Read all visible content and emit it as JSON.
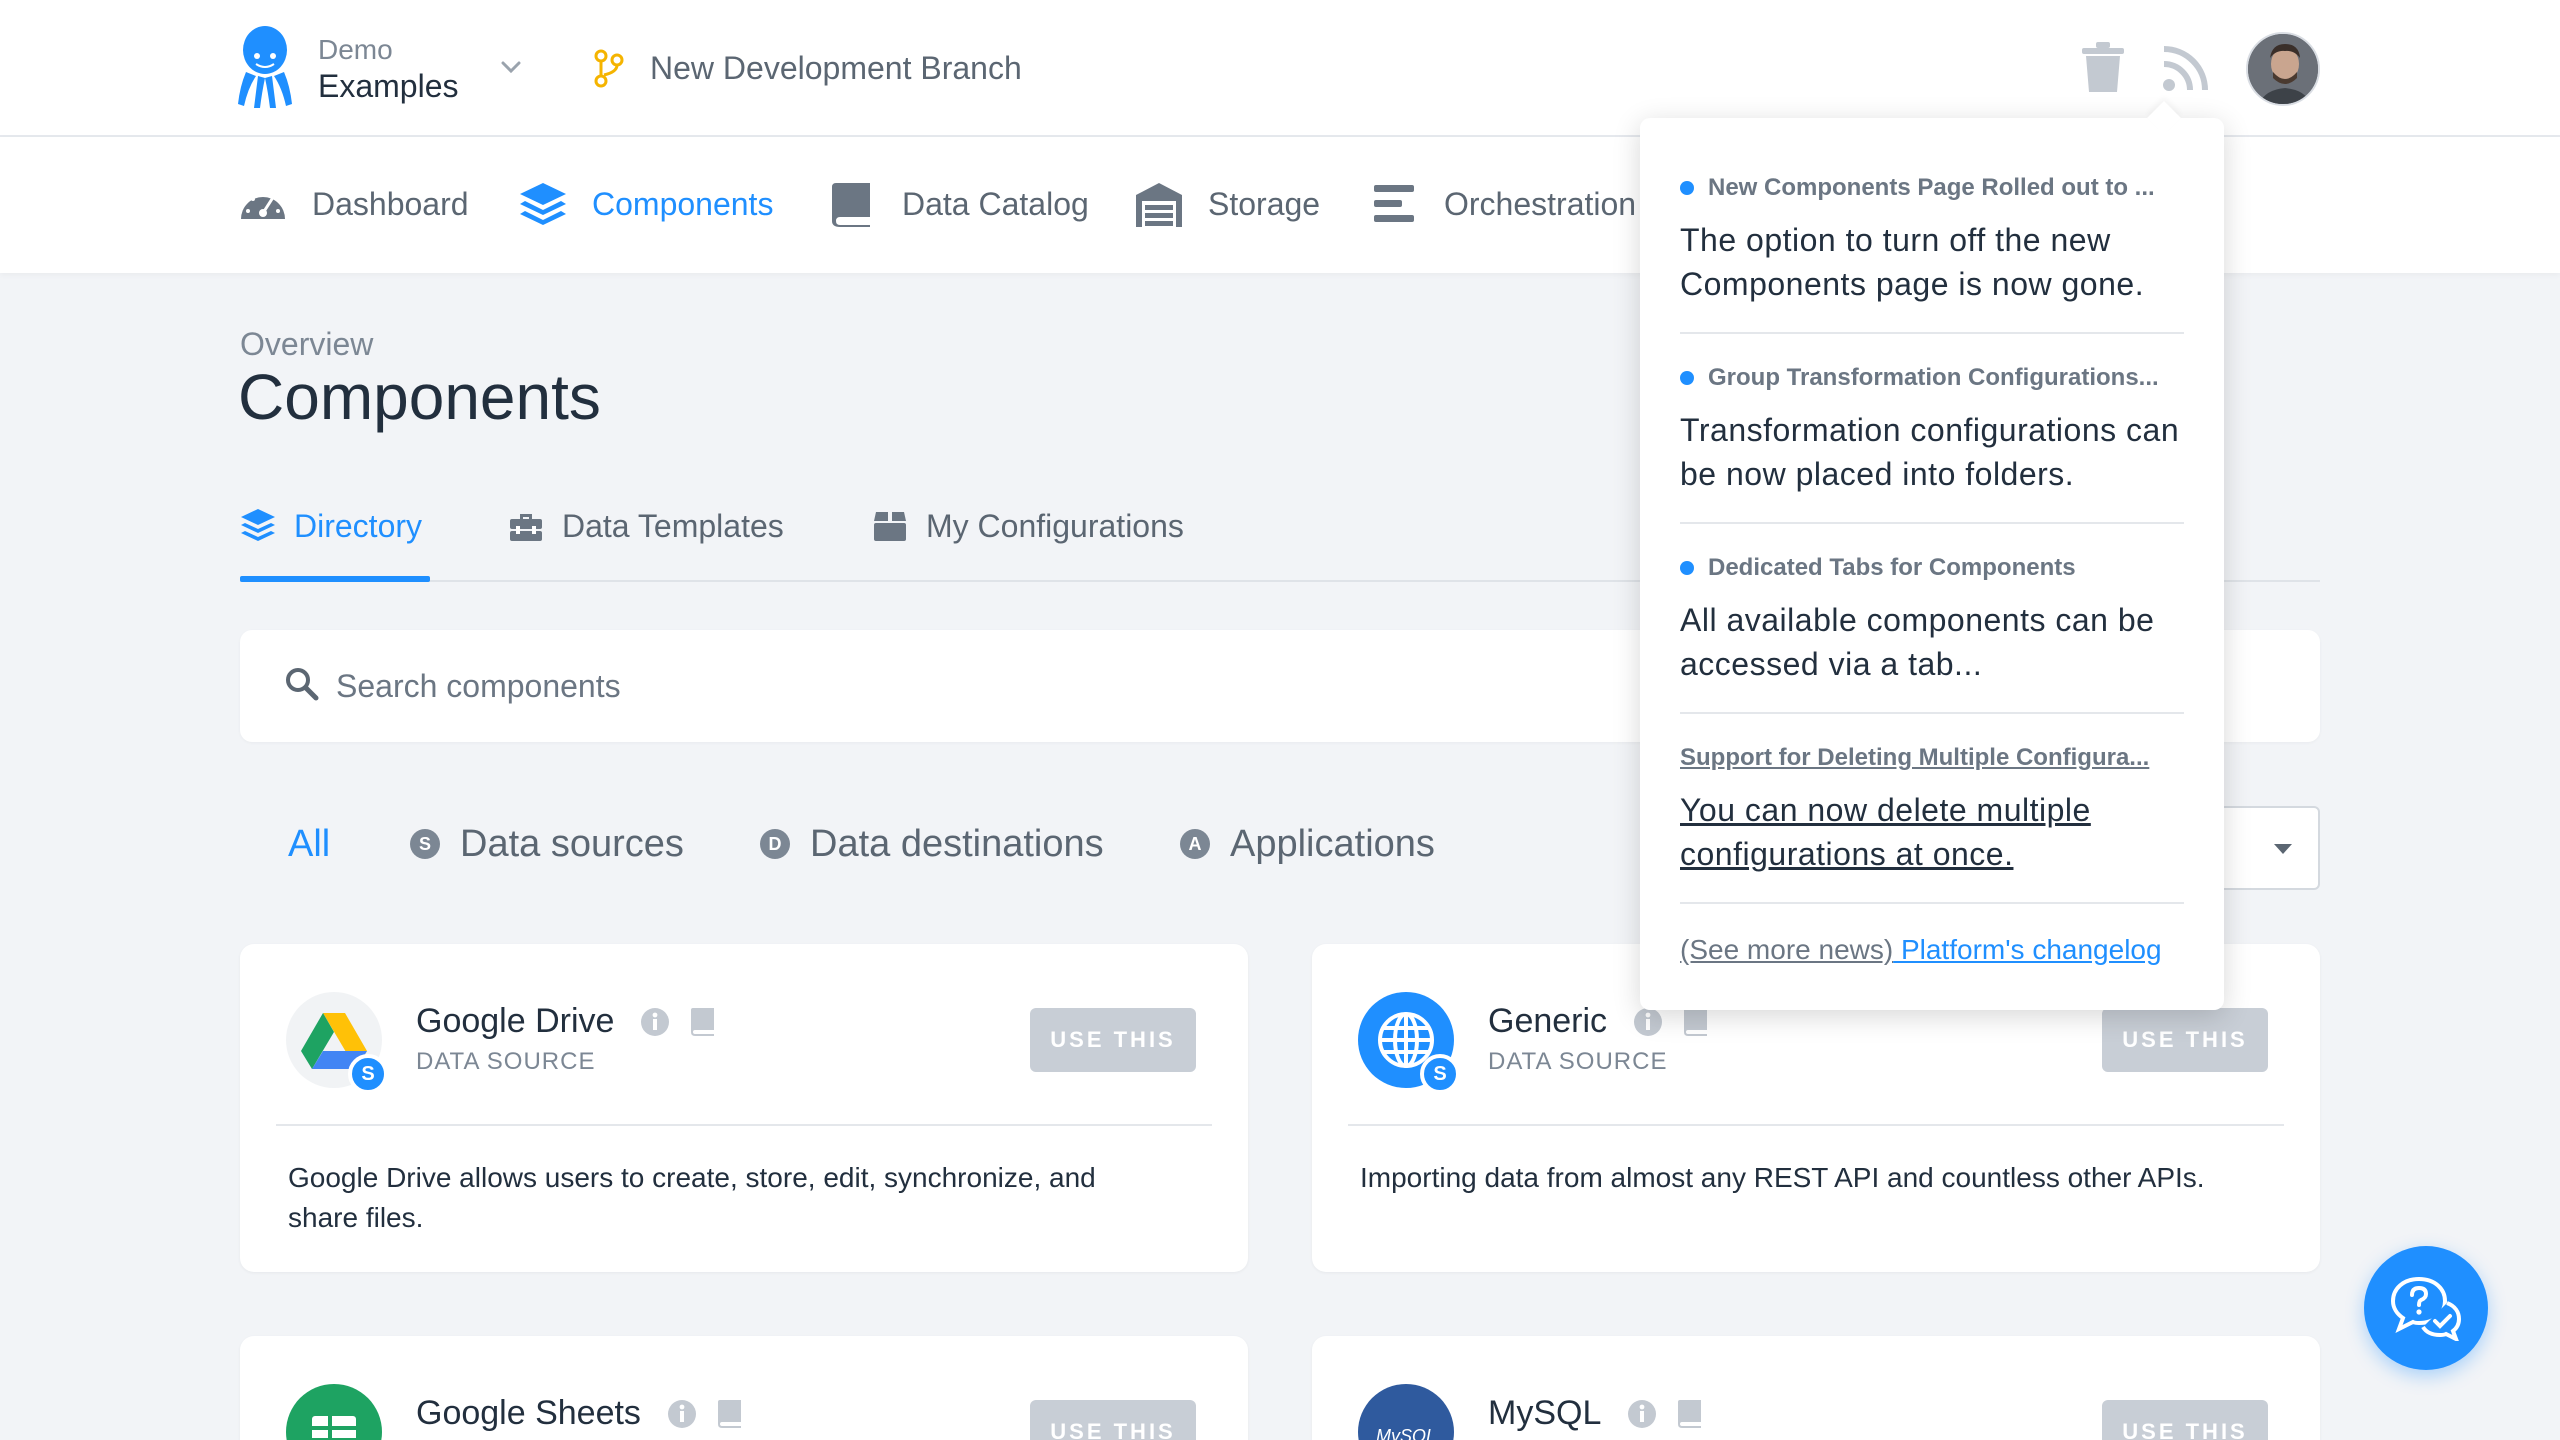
{
  "project": {
    "org": "Demo",
    "name": "Examples"
  },
  "branch": {
    "name": "New Development Branch"
  },
  "nav": [
    {
      "label": "Dashboard",
      "icon": "gauge-icon"
    },
    {
      "label": "Components",
      "icon": "layers-icon",
      "active": true
    },
    {
      "label": "Data Catalog",
      "icon": "book-icon"
    },
    {
      "label": "Storage",
      "icon": "warehouse-icon"
    },
    {
      "label": "Orchestration",
      "icon": "bars-icon"
    }
  ],
  "page": {
    "breadcrumb": "Overview",
    "title": "Components"
  },
  "tabs": [
    {
      "label": "Directory",
      "active": true
    },
    {
      "label": "Data Templates"
    },
    {
      "label": "My Configurations"
    }
  ],
  "search": {
    "placeholder": "Search components"
  },
  "filters": [
    {
      "label": "All",
      "badge": "",
      "active": true
    },
    {
      "label": "Data sources",
      "badge": "S"
    },
    {
      "label": "Data destinations",
      "badge": "D"
    },
    {
      "label": "Applications",
      "badge": "A"
    }
  ],
  "cards": [
    {
      "title": "Google Drive",
      "type": "DATA SOURCE",
      "badge": "S",
      "button": "USE THIS",
      "description": "Google Drive allows users to create, store, edit, synchronize, and share files."
    },
    {
      "title": "Generic",
      "type": "DATA SOURCE",
      "badge": "S",
      "button": "USE THIS",
      "description": "Importing data from almost any REST API and countless other APIs."
    },
    {
      "title": "Google Sheets",
      "button": "USE THIS"
    },
    {
      "title": "MySQL",
      "button": "USE THIS",
      "logo_text": "MySQL"
    }
  ],
  "news": {
    "items": [
      {
        "headline": "New Components Page Rolled out to ...",
        "body": "The option to turn off the new Components page is now gone.",
        "unread": true
      },
      {
        "headline": "Group Transformation Configurations...",
        "body": "Transformation configurations can be now placed into folders.",
        "unread": true
      },
      {
        "headline": "Dedicated Tabs for Components",
        "body": "All available components can be accessed via a tab...",
        "unread": true
      },
      {
        "headline": "Support for Deleting Multiple Configura...",
        "body": "You can now delete multiple configurations at once.",
        "unread": false
      }
    ],
    "more_label": "(See more news)",
    "changelog_label": " Platform's changelog"
  },
  "colors": {
    "accent": "#1f8fff",
    "text": "#222f3e",
    "muted": "#7c8794",
    "button_disabled": "#c8ced6"
  }
}
